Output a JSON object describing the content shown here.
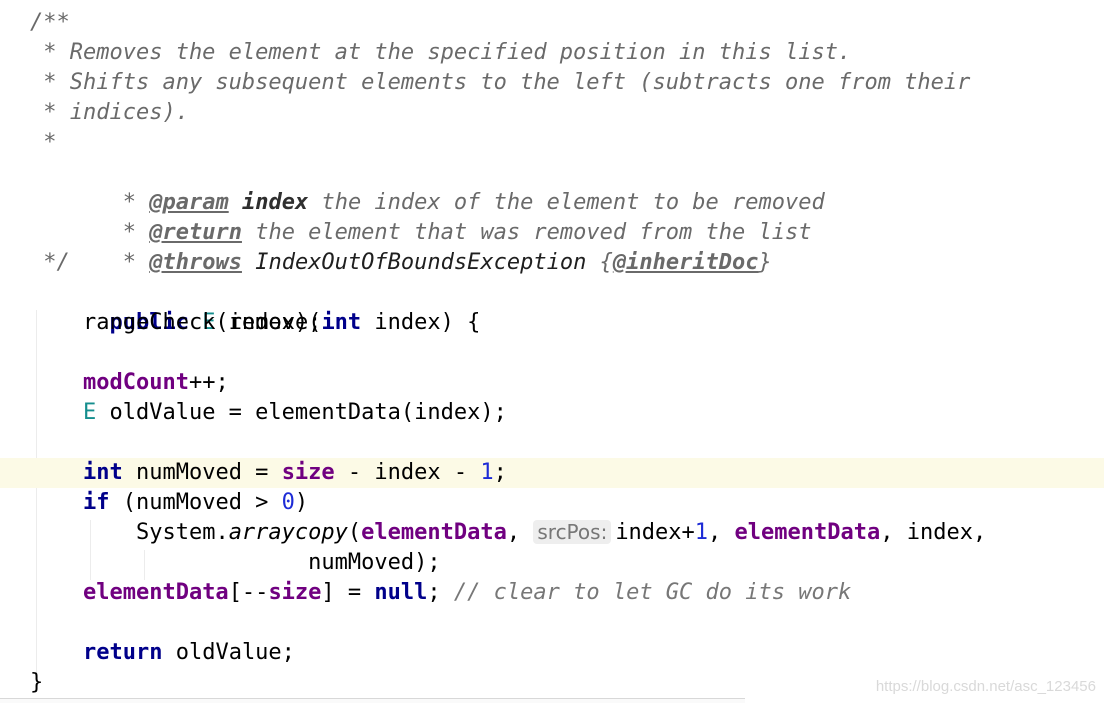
{
  "doc": {
    "open": "/**",
    "line1": " * Removes the element at the specified position in this list.",
    "line2": " * Shifts any subsequent elements to the left (subtracts one from their",
    "line3": " * indices).",
    "line4": " *",
    "star": " * ",
    "param_tag": "@param",
    "param_name": "index",
    "param_desc": " the index of the element to be removed",
    "return_tag": "@return",
    "return_desc": " the element that was removed from the list",
    "throws_tag": "@throws",
    "throws_type": "IndexOutOfBoundsException",
    "inherit_open": "{",
    "inherit_tag": "@inheritDoc",
    "inherit_close": "}",
    "close": " */"
  },
  "code": {
    "kw_public": "public",
    "type_e": "E",
    "method_sig": " remove(",
    "kw_int": "int",
    "param": " index) {",
    "range_check": "rangeCheck(index);",
    "mod_count": "modCount",
    "mod_count_op": "++;",
    "old_value_decl": " oldValue = elementData(index);",
    "num_moved_decl": " numMoved = ",
    "size": "size",
    "num_moved_rest": " - index - ",
    "one": "1",
    "semicolon": ";",
    "kw_if": "if",
    "if_cond": " (numMoved > ",
    "zero": "0",
    "paren_close": ")",
    "system": "System.",
    "arraycopy": "arraycopy",
    "paren_open": "(",
    "element_data": "elementData",
    "comma_space": ", ",
    "hint_srcpos": "srcPos:",
    "index_plus": "index+",
    "dest_rest": ", index,",
    "num_moved_end": "numMoved);",
    "bracket_dec": "[--",
    "assign_null_pre": "] = ",
    "kw_null": "null",
    "comment": " // clear to let GC do its work",
    "kw_return": "return",
    "return_rest": " oldValue;",
    "brace_close": "}"
  },
  "watermark": "https://blog.csdn.net/asc_123456"
}
